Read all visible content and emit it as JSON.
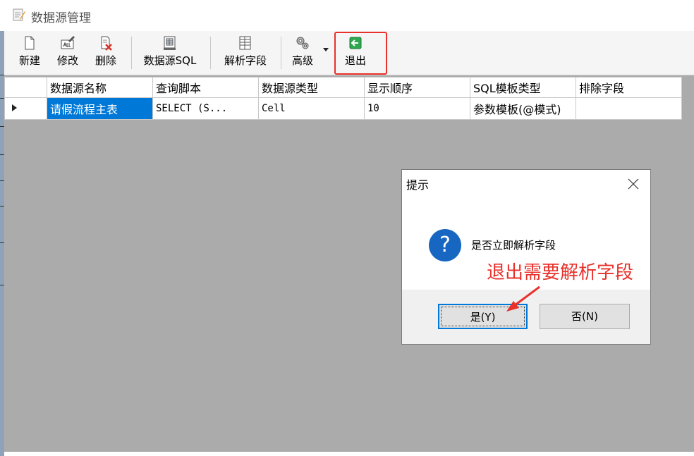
{
  "window": {
    "title": "数据源管理",
    "icon": "document-edit-icon"
  },
  "toolbar": {
    "buttons": [
      {
        "label": "新建",
        "icon": "new-document-icon"
      },
      {
        "label": "修改",
        "icon": "edit-icon"
      },
      {
        "label": "删除",
        "icon": "delete-icon"
      },
      {
        "label": "数据源SQL",
        "icon": "sql-icon"
      },
      {
        "label": "解析字段",
        "icon": "parse-fields-icon"
      },
      {
        "label": "高级",
        "icon": "gears-icon"
      },
      {
        "label": "退出",
        "icon": "exit-arrow-icon"
      }
    ]
  },
  "grid": {
    "columns": [
      "数据源名称",
      "查询脚本",
      "数据源类型",
      "显示顺序",
      "SQL模板类型",
      "排除字段"
    ],
    "rows": [
      [
        "请假流程主表",
        "SELECT    (S...",
        "Cell",
        "10",
        "参数模板(@模式)",
        ""
      ]
    ]
  },
  "dialog": {
    "title": "提示",
    "message": "是否立即解析字段",
    "yes_label": "是(Y)",
    "no_label": "否(N)",
    "icon": "question-icon"
  },
  "annotation": {
    "text": "退出需要解析字段",
    "color": "#e8312b"
  },
  "colors": {
    "selection": "#0078d7",
    "highlight": "#e8312b",
    "grid_background": "#ababab"
  }
}
